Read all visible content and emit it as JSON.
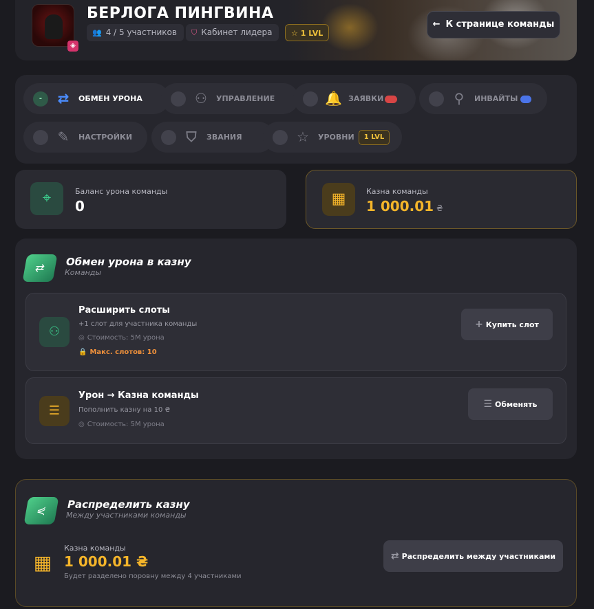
{
  "header": {
    "team_name": "БЕРЛОГА ПИНГВИНА",
    "members": "4 / 5 участников",
    "cabinet": "Кабинет лидера",
    "level": "1 LVL",
    "back_label": "К странице команды"
  },
  "tabs": [
    {
      "label": "ОБМЕН УРОНА",
      "icon": "exchange-icon",
      "active": true
    },
    {
      "label": "УПРАВЛЕНИЕ",
      "icon": "users-icon",
      "active": false
    },
    {
      "label": "ЗАЯВКИ",
      "icon": "bell-icon",
      "active": false
    },
    {
      "label": "ИНВАЙТЫ",
      "icon": "user-plus-icon",
      "active": false
    },
    {
      "label": "НАСТРОЙКИ",
      "icon": "edit-icon",
      "active": false
    },
    {
      "label": "ЗВАНИЯ",
      "icon": "shield-icon",
      "active": false
    },
    {
      "label": "УРОВНИ",
      "icon": "star-icon",
      "active": false,
      "badge": "1 LVL"
    }
  ],
  "active_tab_dot": "-",
  "balance": {
    "label": "Баланс урона команды",
    "value": "0"
  },
  "treasury": {
    "label": "Казна команды",
    "value": "1 000.01",
    "currency": "₴"
  },
  "exchange": {
    "title": "Обмен урона в казну",
    "subtitle": "Команды",
    "slots": {
      "title": "Расширить слоты",
      "desc": "+1 слот для участника команды",
      "cost": "Стоимость: 5M урона",
      "max": "Макс. слотов: 10",
      "button": "Купить слот"
    },
    "swap": {
      "title": "Урон → Казна команды",
      "desc": "Пополнить казну на 10 ₴",
      "cost": "Стоимость: 5M урона",
      "button": "Обменять"
    }
  },
  "distribute": {
    "title": "Распределить казну",
    "subtitle": "Между участниками команды",
    "label": "Казна команды",
    "value": "1 000.01 ₴",
    "note": "Будет разделено поровну между 4 участниками",
    "button": "Распределить между участниками"
  },
  "colors": {
    "accent_gold": "#f5b52a",
    "accent_green": "#3ccf8e",
    "accent_blue": "#4b8dff",
    "background": "#1b1b20"
  }
}
